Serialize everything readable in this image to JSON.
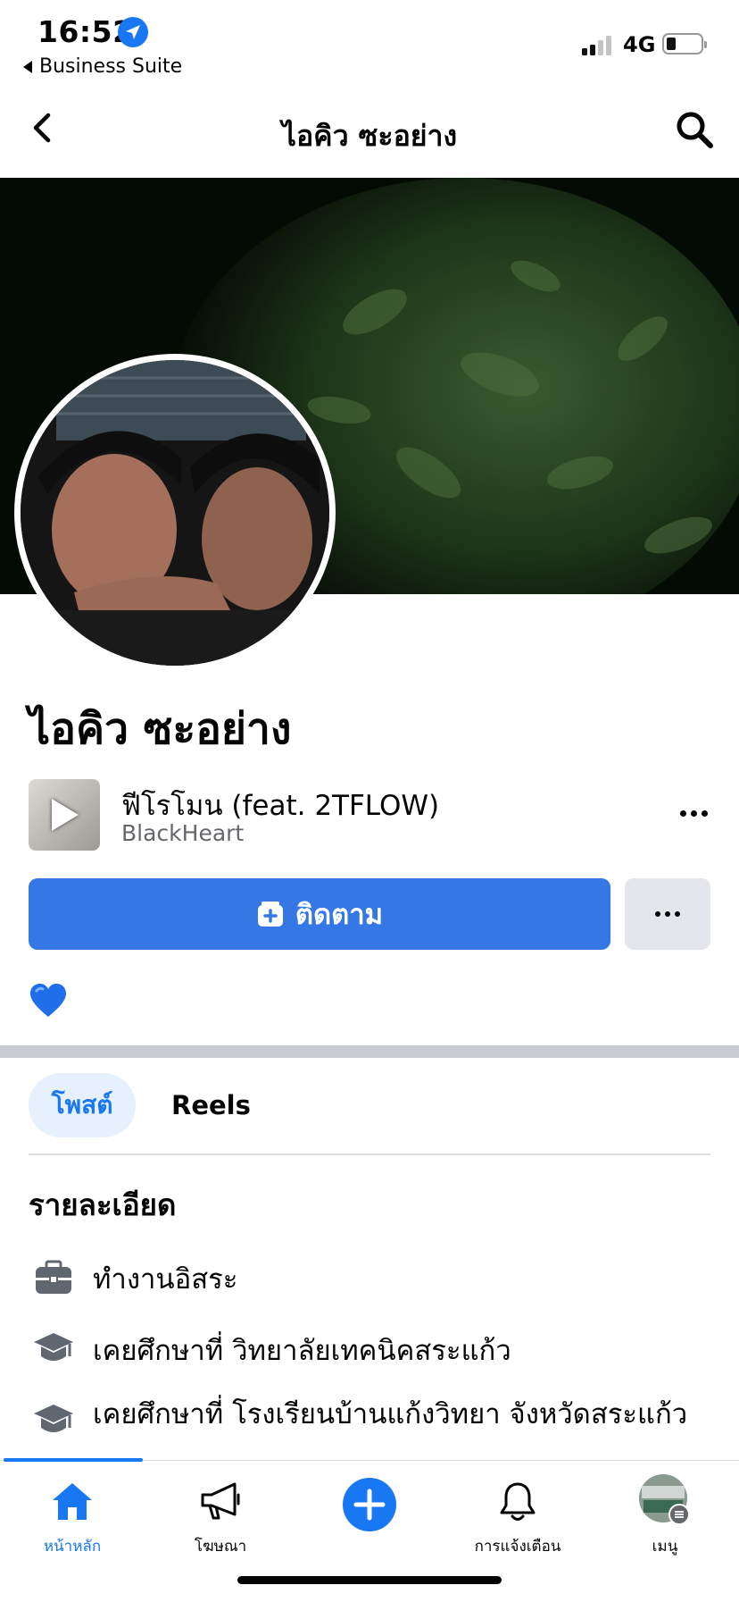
{
  "status_bar": {
    "time": "16:52",
    "back_app": "Business Suite",
    "network": "4G",
    "icons": [
      "location-arrow-icon",
      "signal-icon",
      "battery-icon"
    ]
  },
  "nav": {
    "title": "ไอคิว ซะอย่าง",
    "back_icon": "chevron-left-icon",
    "search_icon": "search-icon"
  },
  "profile": {
    "name": "ไอคิว ซะอย่าง",
    "bio_emoji": "💙"
  },
  "song": {
    "title": "ฟีโรโมน (feat. 2TFLOW)",
    "artist": "BlackHeart"
  },
  "actions": {
    "follow_label": "ติดตาม",
    "follow_icon": "follow-plus-icon",
    "more_icon": "more-dots-icon"
  },
  "tabs": {
    "posts": "โพสต์",
    "reels": "Reels"
  },
  "details": {
    "heading": "รายละเอียด",
    "items": [
      {
        "icon": "briefcase-icon",
        "text": "ทำงานอิสระ"
      },
      {
        "icon": "graduation-cap-icon",
        "text": "เคยศึกษาที่ วิทยาลัยเทคนิคสระแก้ว"
      },
      {
        "icon": "graduation-cap-icon",
        "text": "เคยศึกษาที่ โรงเรียนบ้านแก้งวิทยา จังหวัดสระแก้ว"
      }
    ]
  },
  "tabbar": {
    "items": [
      {
        "label": "หน้าหลัก",
        "icon": "home-icon",
        "active": true
      },
      {
        "label": "โฆษณา",
        "icon": "megaphone-icon",
        "active": false
      },
      {
        "label": "",
        "icon": "create-plus-icon",
        "active": false
      },
      {
        "label": "การแจ้งเตือน",
        "icon": "bell-icon",
        "active": false
      },
      {
        "label": "เมนู",
        "icon": "menu-avatar-icon",
        "active": false
      }
    ]
  },
  "colors": {
    "accent": "#1877f2",
    "button_blue": "#3578e5",
    "secondary_button": "#e4e6eb",
    "divider": "#c9ccd1"
  }
}
